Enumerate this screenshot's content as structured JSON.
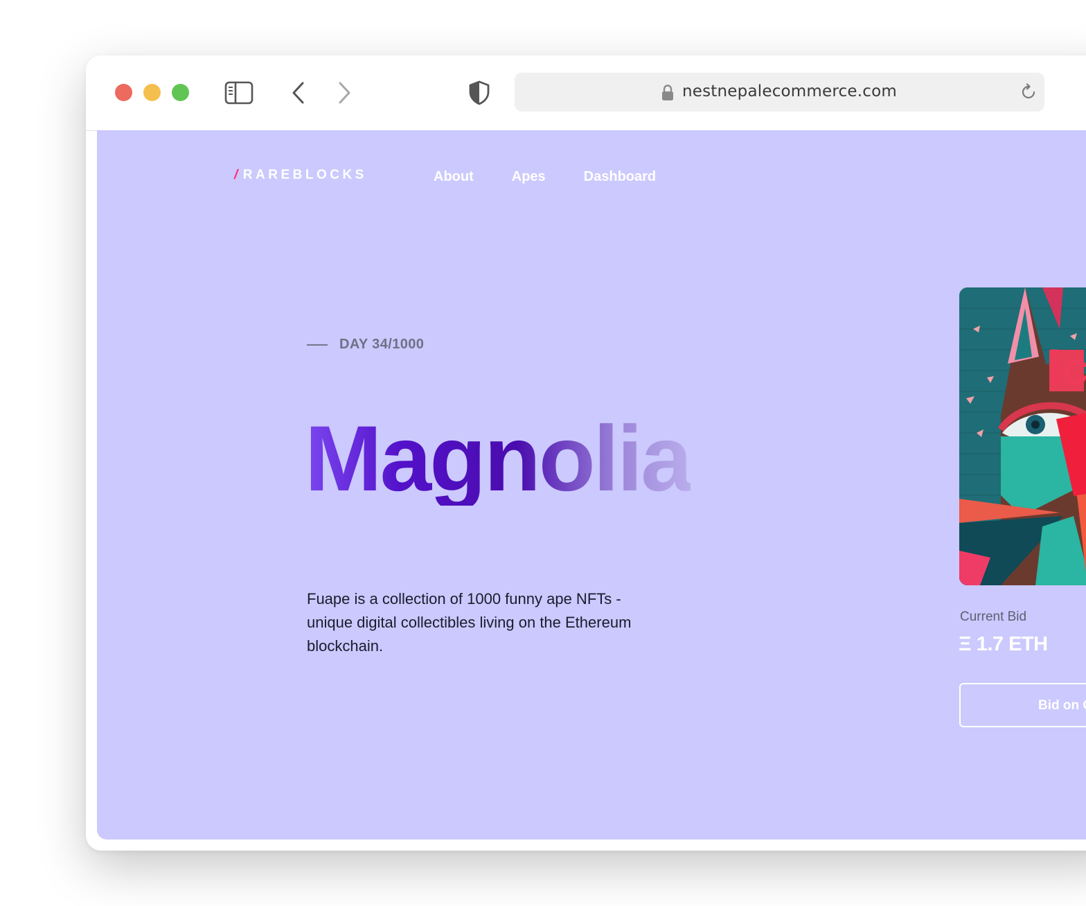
{
  "browser": {
    "url": "nestnepalecommerce.com",
    "traffic_lights": {
      "close": "#ec6a5e",
      "minimize": "#f4bf4f",
      "zoom": "#61c554"
    },
    "icons": [
      "sidebar-icon",
      "back-icon",
      "forward-icon",
      "shield-icon",
      "lock-icon",
      "reload-icon"
    ]
  },
  "site": {
    "logo_slash": "/",
    "logo_text": "RAREBLOCKS",
    "nav": [
      {
        "label": "About"
      },
      {
        "label": "Apes"
      },
      {
        "label": "Dashboard"
      }
    ]
  },
  "hero": {
    "eyebrow": "DAY 34/1000",
    "title": "Magnolia",
    "description": "Fuape is a collection of 1000 funny ape NFTs - unique digital collectibles living on the Ethereum blockchain."
  },
  "auction": {
    "current_bid_label": "Current Bid",
    "current_bid_value": "Ξ 1.7 ETH",
    "bid_button_label": "Bid on C"
  },
  "colors": {
    "page_background": "#cbc9fd",
    "logo_accent": "#ff2d6e",
    "title_gradient": [
      "#7b46ef",
      "#4a0cae",
      "#b9adeb"
    ]
  }
}
